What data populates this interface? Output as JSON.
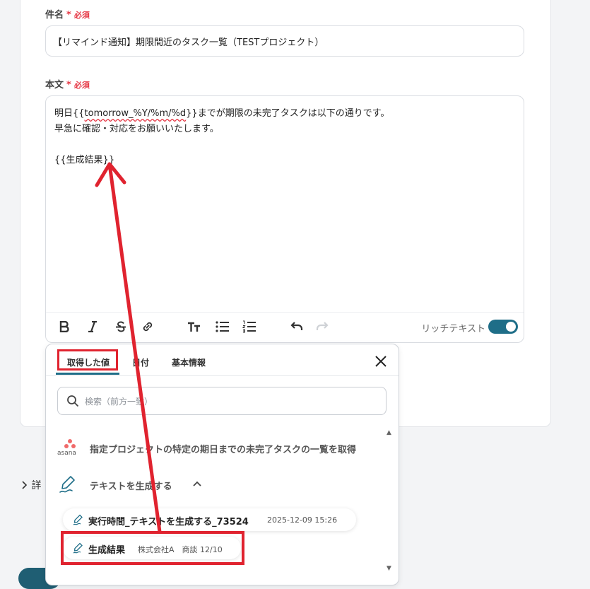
{
  "form": {
    "subject": {
      "label": "件名",
      "required_label": "必須",
      "value": "【リマインド通知】期限間近のタスク一覧（TESTプロジェクト）"
    },
    "body": {
      "label": "本文",
      "required_label": "必須",
      "line1_prefix": "明日{{",
      "line1_var": "tomorrow_%Y/%m/%d",
      "line1_suffix": "}}までが期限の未完了タスクは以下の通りです。",
      "line2": "早急に確認・対応をお願いいたします。",
      "line4": "{{生成結果}}"
    },
    "toolbar": {
      "rich_text_label": "リッチテキスト",
      "rich_text_enabled": true
    }
  },
  "details_label": "詳",
  "popup": {
    "tabs": [
      {
        "label": "取得した値",
        "active": true
      },
      {
        "label": "日付",
        "active": false
      },
      {
        "label": "基本情報",
        "active": false
      }
    ],
    "search": {
      "placeholder": "検索（前方一致）"
    },
    "asana": {
      "logo_text": "asana",
      "title": "指定プロジェクトの特定の期日までの未完了タスクの一覧を取得"
    },
    "text_generation": {
      "title": "テキストを生成する"
    },
    "items": [
      {
        "name": "実行時間_テキストを生成する_73524",
        "meta": "2025-12-09 15:26"
      },
      {
        "name": "生成結果",
        "meta": "株式会社A　商談 12/10"
      }
    ]
  },
  "colors": {
    "accent": "#1f6e88",
    "required": "#e63946",
    "annotation_red": "#e0232f",
    "asana": "#f06a6a"
  }
}
